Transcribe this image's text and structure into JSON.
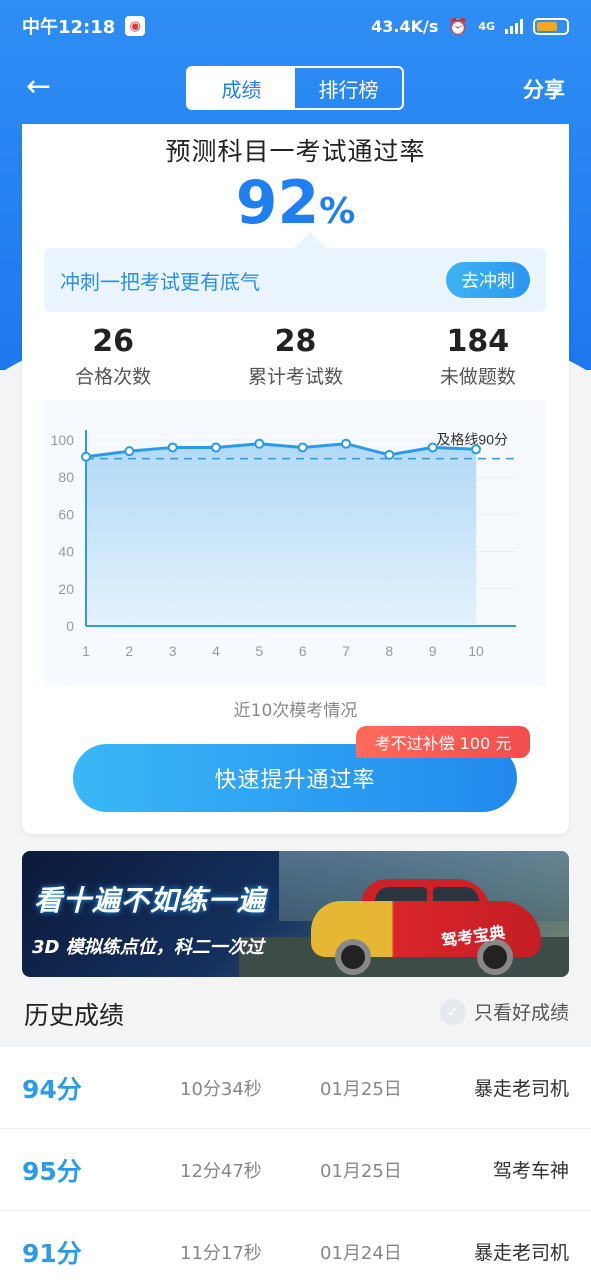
{
  "status_bar": {
    "time": "中午12:18",
    "net_speed": "43.4K/s",
    "network": "4G"
  },
  "nav": {
    "tabs": [
      {
        "label": "成绩",
        "active": true
      },
      {
        "label": "排行榜",
        "active": false
      }
    ],
    "share_label": "分享"
  },
  "prediction": {
    "title": "预测科目一考试通过率",
    "value": "92",
    "unit": "%"
  },
  "tip": {
    "text": "冲刺一把考试更有底气",
    "button": "去冲刺"
  },
  "stats": [
    {
      "value": "26",
      "label": "合格次数"
    },
    {
      "value": "28",
      "label": "累计考试数"
    },
    {
      "value": "184",
      "label": "未做题数"
    }
  ],
  "chart_data": {
    "type": "area",
    "x": [
      1,
      2,
      3,
      4,
      5,
      6,
      7,
      8,
      9,
      10
    ],
    "series": [
      {
        "values": [
          91,
          94,
          96,
          96,
          98,
          96,
          98,
          92,
          96,
          95
        ]
      }
    ],
    "ylim": [
      0,
      100
    ],
    "yticks": [
      0,
      20,
      40,
      60,
      80,
      100
    ],
    "threshold": {
      "value": 90,
      "label": "及格线90分"
    },
    "caption": "近10次模考情况",
    "colors": {
      "line": "#2b9be6",
      "fill": "#bfe0f7",
      "threshold": "#2b9be6"
    }
  },
  "promo": {
    "badge": "考不过补偿 100 元",
    "button": "快速提升通过率"
  },
  "banner": {
    "line1": "看十遍不如练一遍",
    "line2": "3D 模拟练点位，科二一次过",
    "car_text": "驾考宝典"
  },
  "history": {
    "title": "历史成绩",
    "filter_label": "只看好成绩",
    "rows": [
      {
        "score": "94分",
        "duration": "10分34秒",
        "date": "01月25日",
        "user": "暴走老司机"
      },
      {
        "score": "95分",
        "duration": "12分47秒",
        "date": "01月25日",
        "user": "驾考车神"
      },
      {
        "score": "91分",
        "duration": "11分17秒",
        "date": "01月24日",
        "user": "暴走老司机"
      }
    ]
  }
}
